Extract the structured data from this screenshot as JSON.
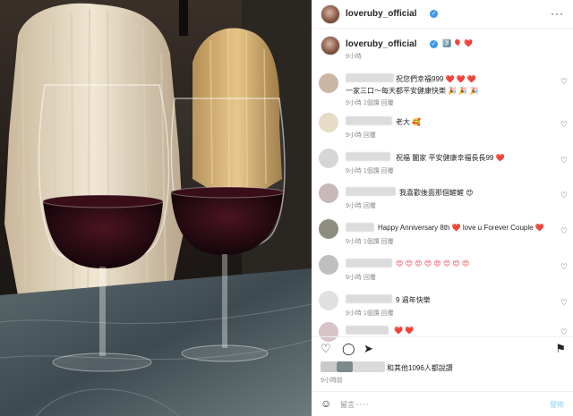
{
  "header": {
    "username": "loveruby_official",
    "verified_glyph": "✓",
    "more_glyph": "···"
  },
  "caption": {
    "username": "loveruby_official",
    "verified_glyph": "✓",
    "emojis": "7️⃣ 🎈 ❤️",
    "time": "9小時"
  },
  "comments": [
    {
      "text": "祝您們幸福999 ❤️ ❤️ ❤️",
      "text2": "一家三口～每天都平安健康快樂 🎉 🎉 🎉",
      "meta": "9小時  1個讚  回覆"
    },
    {
      "text": "老大 🥰",
      "meta": "9小時  回覆"
    },
    {
      "text": "祝福 闔家 平安健康幸福長長99 ❤️",
      "meta": "9小時  1個讚  回覆"
    },
    {
      "text": "我喜歡後面那個鏟鏟 😍",
      "meta": "9小時  回覆"
    },
    {
      "text": "Happy Anniversary 8th ❤️ love u Forever Couple ❤️",
      "meta": "9小時  1個讚  回覆"
    },
    {
      "text": "😍 😍 😍 😍 😍 😍 😍 😍",
      "meta": "9小時  回覆"
    },
    {
      "text": "9 週年快樂",
      "meta": "9小時  1個讚  回覆"
    },
    {
      "text": "❤️ ❤️",
      "meta": ""
    }
  ],
  "actions": {
    "like": "♡",
    "comment": "◯",
    "share": "➤",
    "save": "⚑"
  },
  "likes": {
    "text": "和其他1096人都說讚",
    "time": "9小時前"
  },
  "input": {
    "emoji": "☺",
    "placeholder": "留言⋯⋯",
    "post_label": "發佈"
  },
  "colors": {
    "accent": "#3897f0",
    "heart": "#ed4956",
    "meta": "#8e8e8e"
  }
}
